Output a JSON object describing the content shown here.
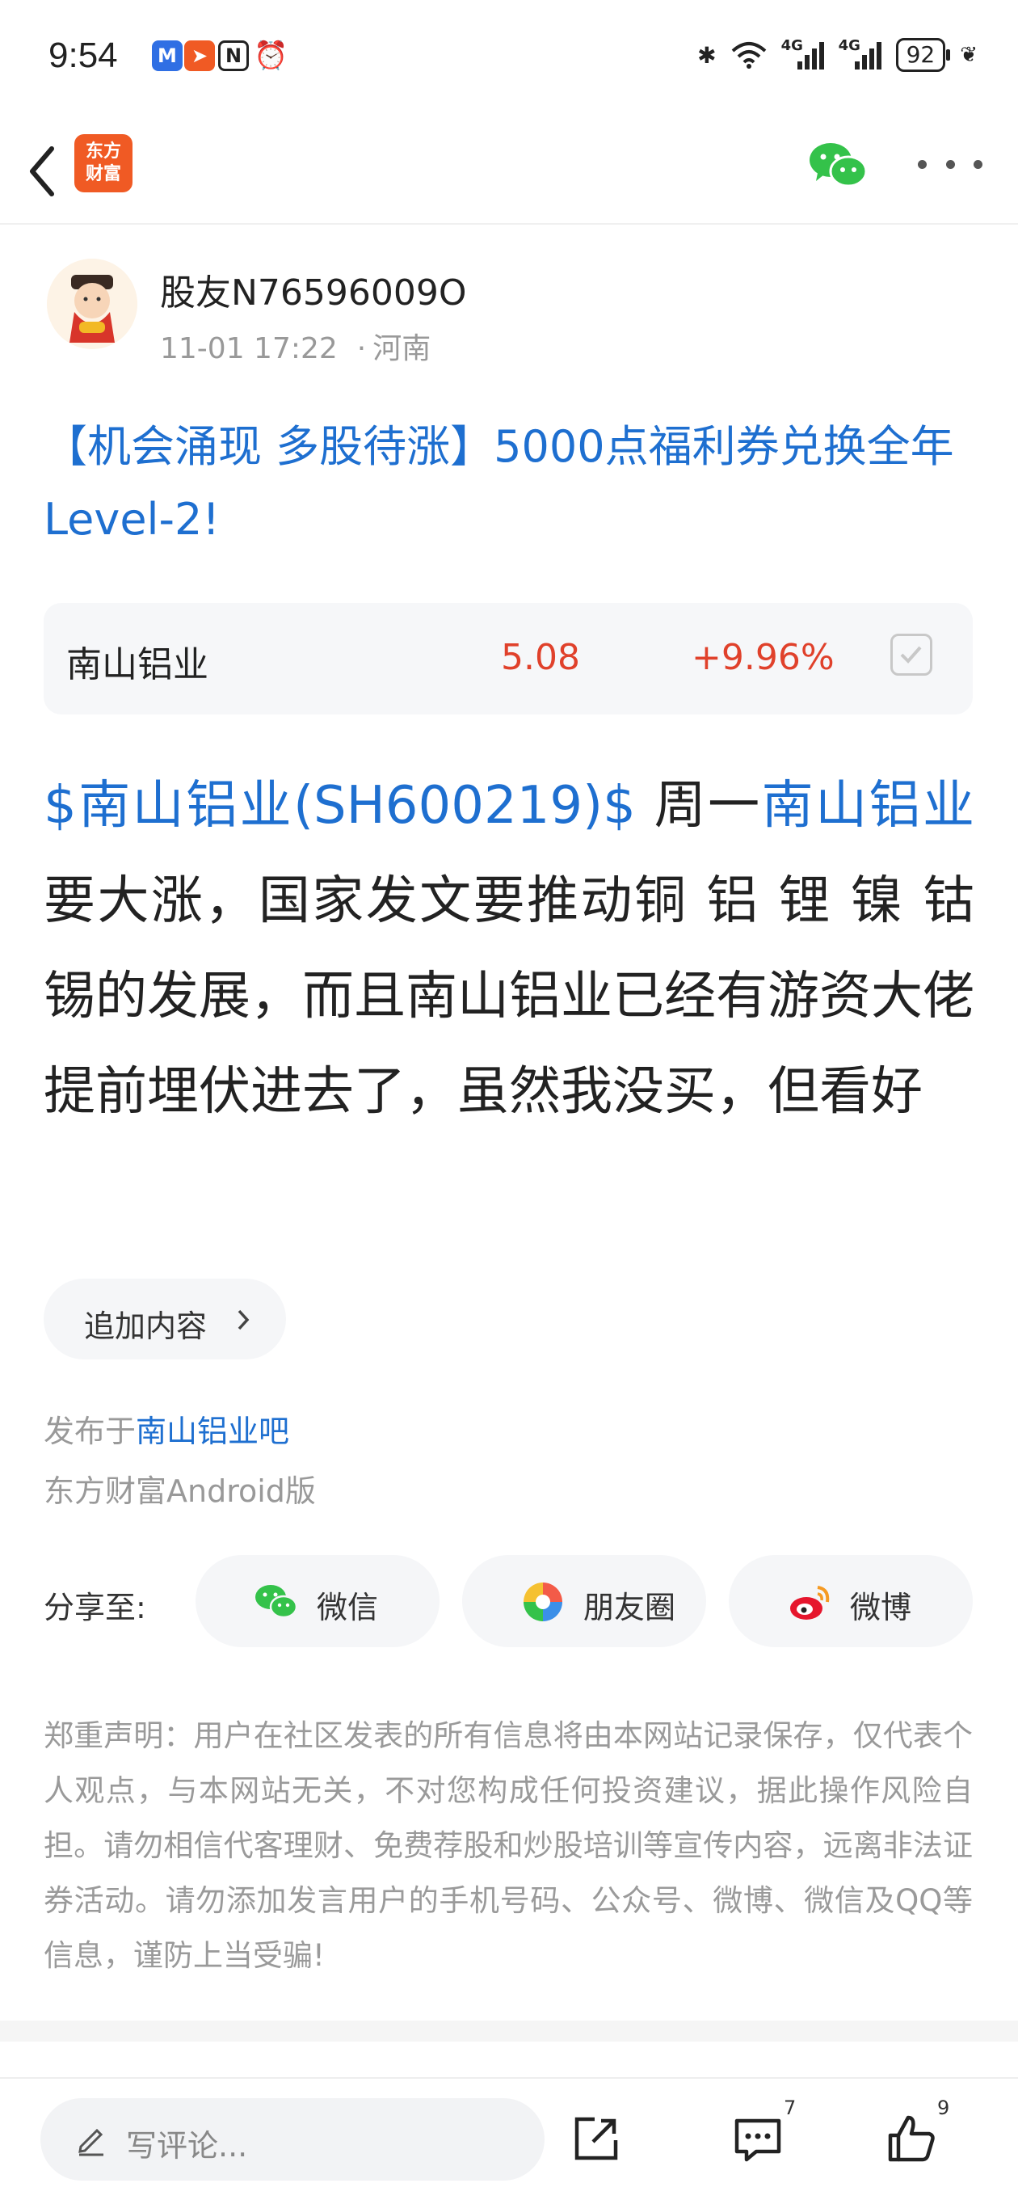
{
  "status_bar": {
    "time": "9:54",
    "battery": "92",
    "network": "4G"
  },
  "nav": {
    "logo_text_line1": "东方",
    "logo_text_line2": "财富"
  },
  "post": {
    "author": "股友N76596009O",
    "datetime": "11-01 17:22",
    "location": "河南",
    "title": "【机会涌现 多股待涨】5000点福利券兑换全年Level-2!",
    "body_link1": "$南山铝业(SH600219)$",
    "body_text1": " 周一",
    "body_link2": "南山铝业",
    "body_text2": "要大涨，国家发文要推动铜 铝 锂 镍 钴 锡的发展，而且南山铝业已经有游资大佬提前埋伏进去了，虽然我没买，但看好"
  },
  "stock_card": {
    "name": "南山铝业",
    "price": "5.08",
    "change": "+9.96%"
  },
  "addon": {
    "label": "追加内容"
  },
  "posted_in": {
    "prefix": "发布于",
    "forum": "南山铝业吧"
  },
  "client": "东方财富Android版",
  "share": {
    "label": "分享至:",
    "wechat": "微信",
    "moments": "朋友圈",
    "weibo": "微博"
  },
  "disclaimer": "郑重声明：用户在社区发表的所有信息将由本网站记录保存，仅代表个人观点，与本网站无关，不对您构成任何投资建议，据此操作风险自担。请勿相信代客理财、免费荐股和炒股培训等宣传内容，远离非法证券活动。请勿添加发言用户的手机号码、公众号、微博、微信及QQ等信息，谨防上当受骗!",
  "bottom_bar": {
    "comment_placeholder": "写评论...",
    "comment_count": "7",
    "like_count": "9"
  },
  "colors": {
    "link": "#1e6fd0",
    "up": "#e0412b",
    "brand": "#f05a24"
  }
}
